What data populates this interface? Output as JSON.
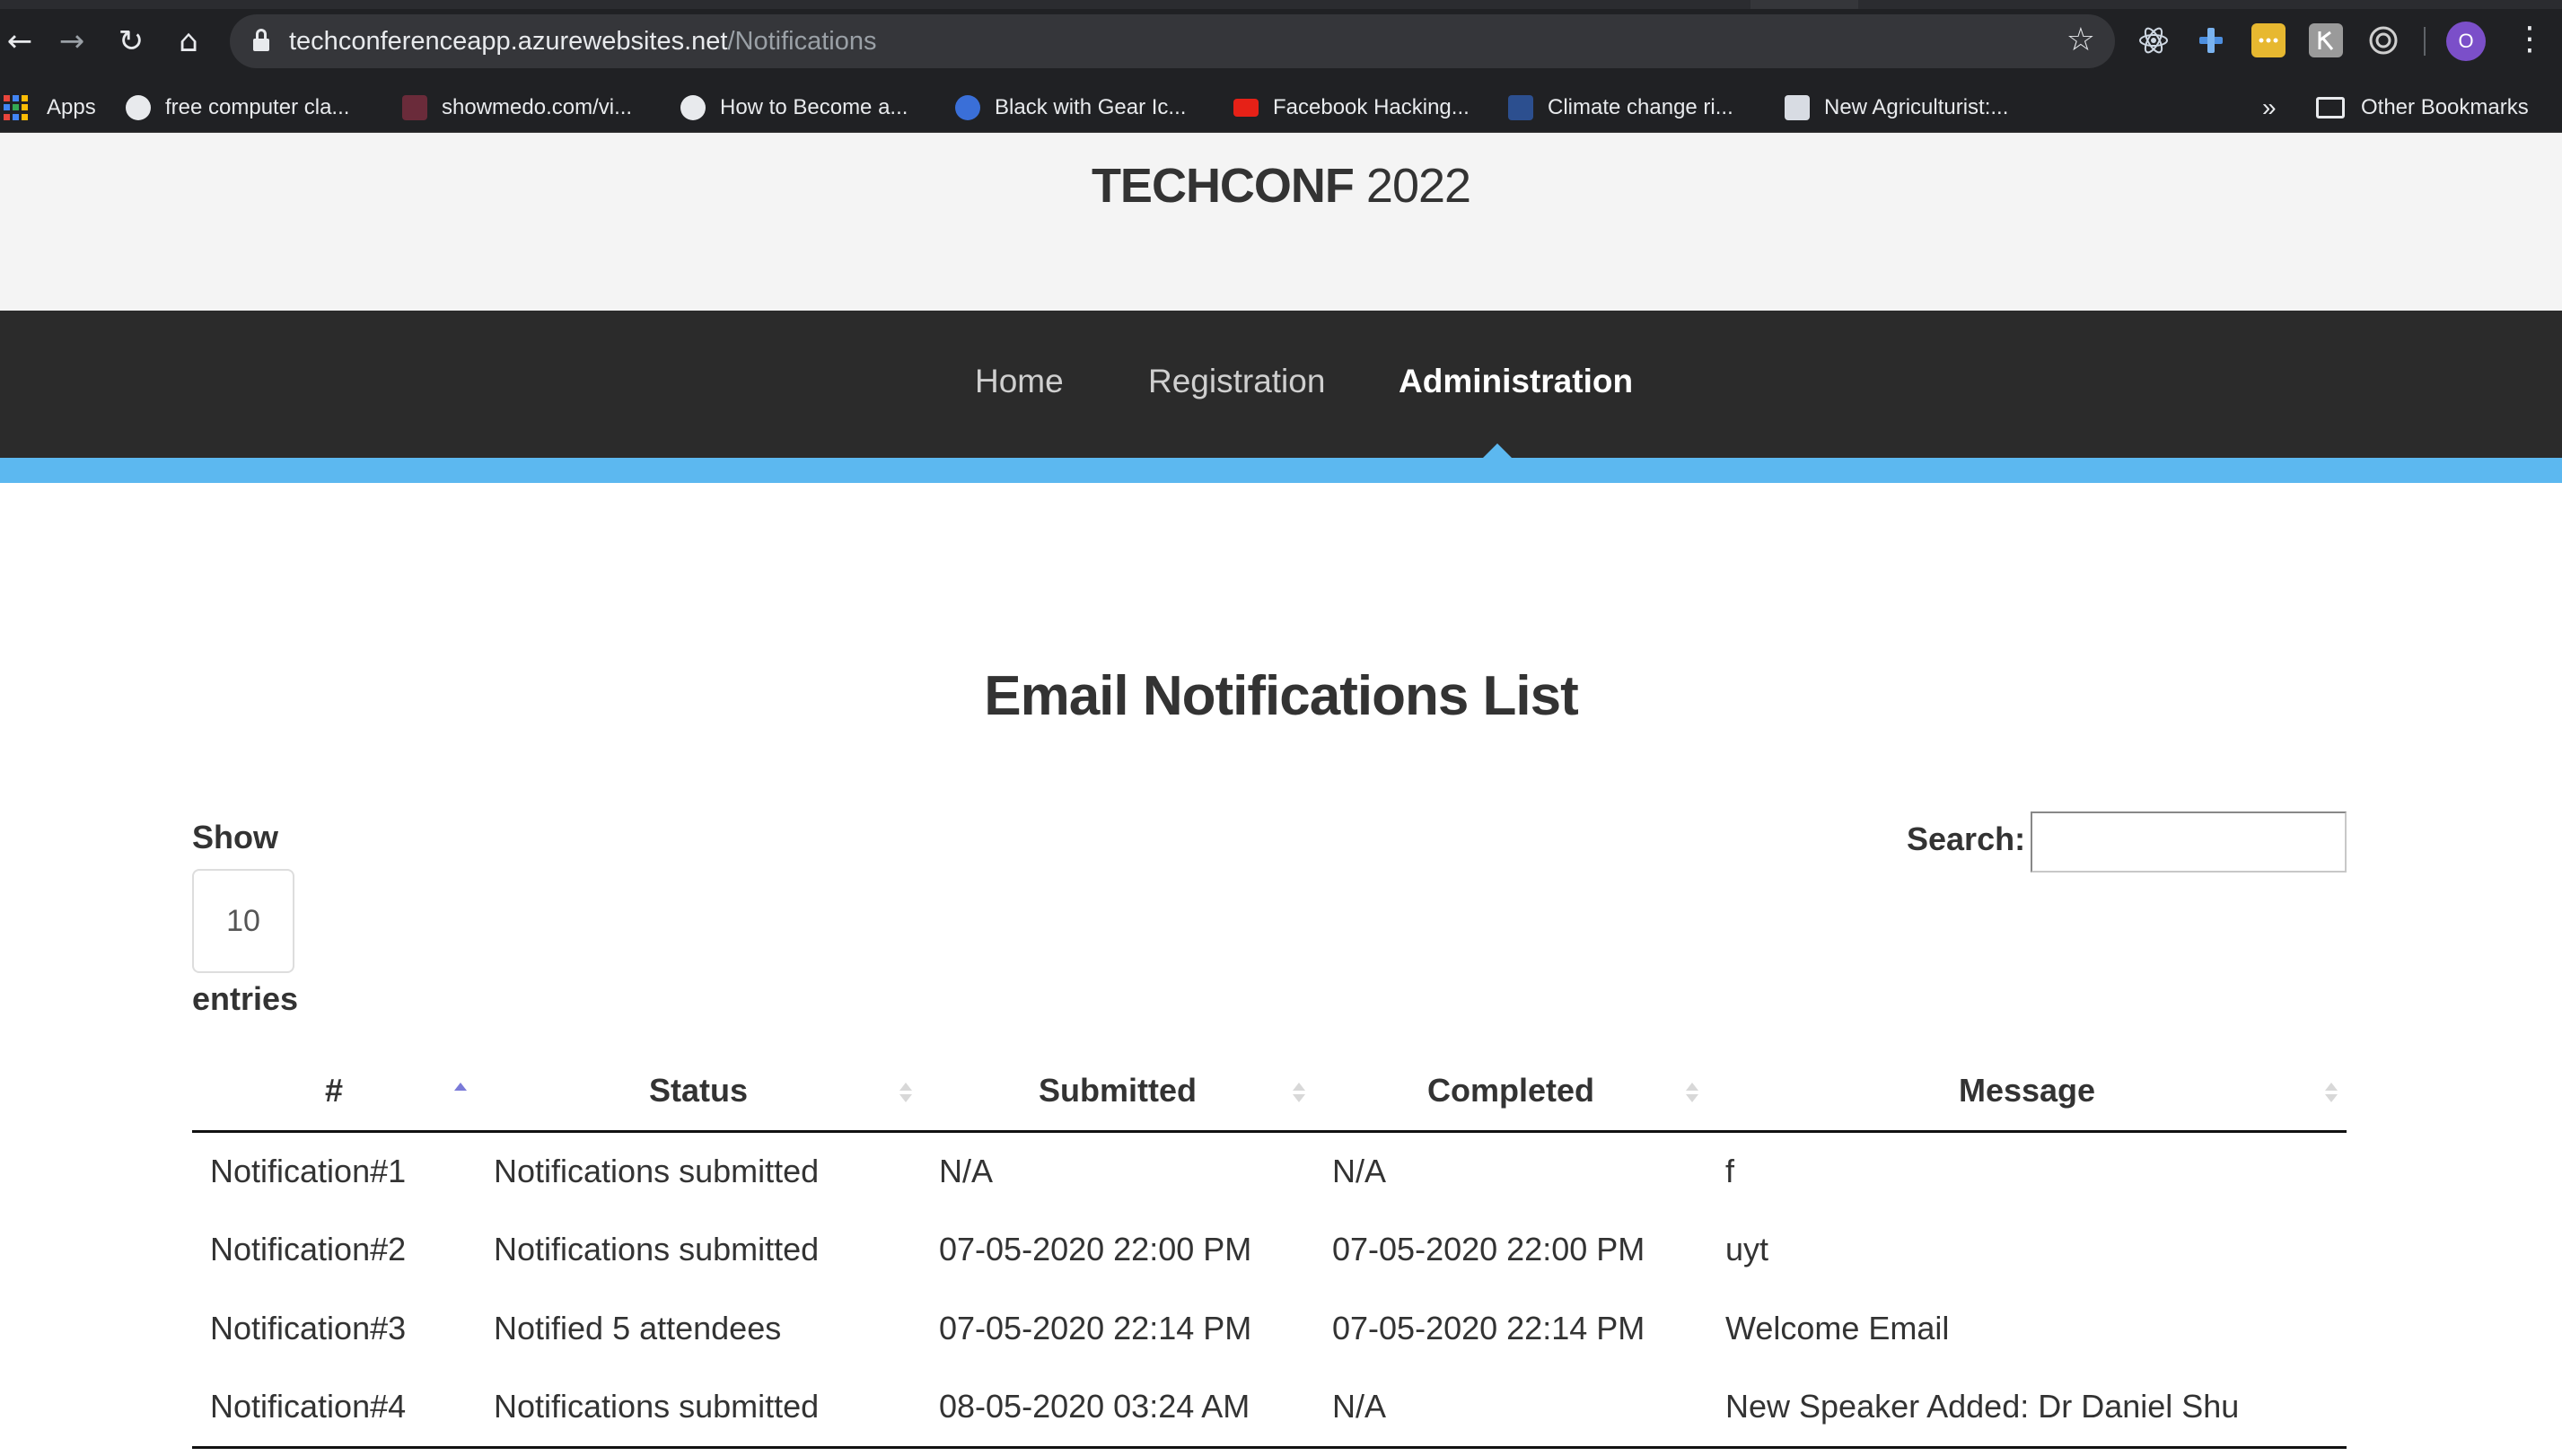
{
  "browser": {
    "url_host": "techconferenceapp.azurewebsites.net",
    "url_path": "/Notifications",
    "profile_initial": "O",
    "bookmarks": [
      {
        "label": "Apps",
        "icon": "apps-grid-icon"
      },
      {
        "label": "free computer cla...",
        "icon": "globe-icon"
      },
      {
        "label": "showmedo.com/vi...",
        "icon": "showmedo-icon"
      },
      {
        "label": "How to Become a...",
        "icon": "globe-icon"
      },
      {
        "label": "Black with Gear Ic...",
        "icon": "c-logo-icon"
      },
      {
        "label": "Facebook Hacking...",
        "icon": "youtube-icon"
      },
      {
        "label": "Climate change ri...",
        "icon": "pnas-icon"
      },
      {
        "label": "New Agriculturist:...",
        "icon": "na-icon"
      }
    ],
    "overflow": "»",
    "other_bookmarks": "Other Bookmarks"
  },
  "site": {
    "brand_bold": "TECHCONF",
    "brand_year": " 2022"
  },
  "nav": {
    "home": "Home",
    "registration": "Registration",
    "administration": "Administration",
    "active": "administration"
  },
  "page": {
    "title": "Email Notifications List",
    "show_label": "Show",
    "entries_value": "10",
    "entries_label": "entries",
    "search_label": "Search:",
    "search_value": ""
  },
  "table": {
    "columns": [
      "#",
      "Status",
      "Submitted",
      "Completed",
      "Message"
    ],
    "sorted_column": "#",
    "sort_direction": "asc",
    "rows": [
      [
        "Notification#1",
        "Notifications submitted",
        "N/A",
        "N/A",
        "f"
      ],
      [
        "Notification#2",
        "Notifications submitted",
        "07-05-2020 22:00 PM",
        "07-05-2020 22:00 PM",
        "uyt"
      ],
      [
        "Notification#3",
        "Notified 5 attendees",
        "07-05-2020 22:14 PM",
        "07-05-2020 22:14 PM",
        "Welcome Email"
      ],
      [
        "Notification#4",
        "Notifications submitted",
        "08-05-2020 03:24 AM",
        "N/A",
        "New Speaker Added: Dr Daniel Shu"
      ]
    ]
  },
  "colors": {
    "navbar": "#2b2b2b",
    "accent": "#5cb8f0",
    "header_bg": "#f4f4f4"
  }
}
